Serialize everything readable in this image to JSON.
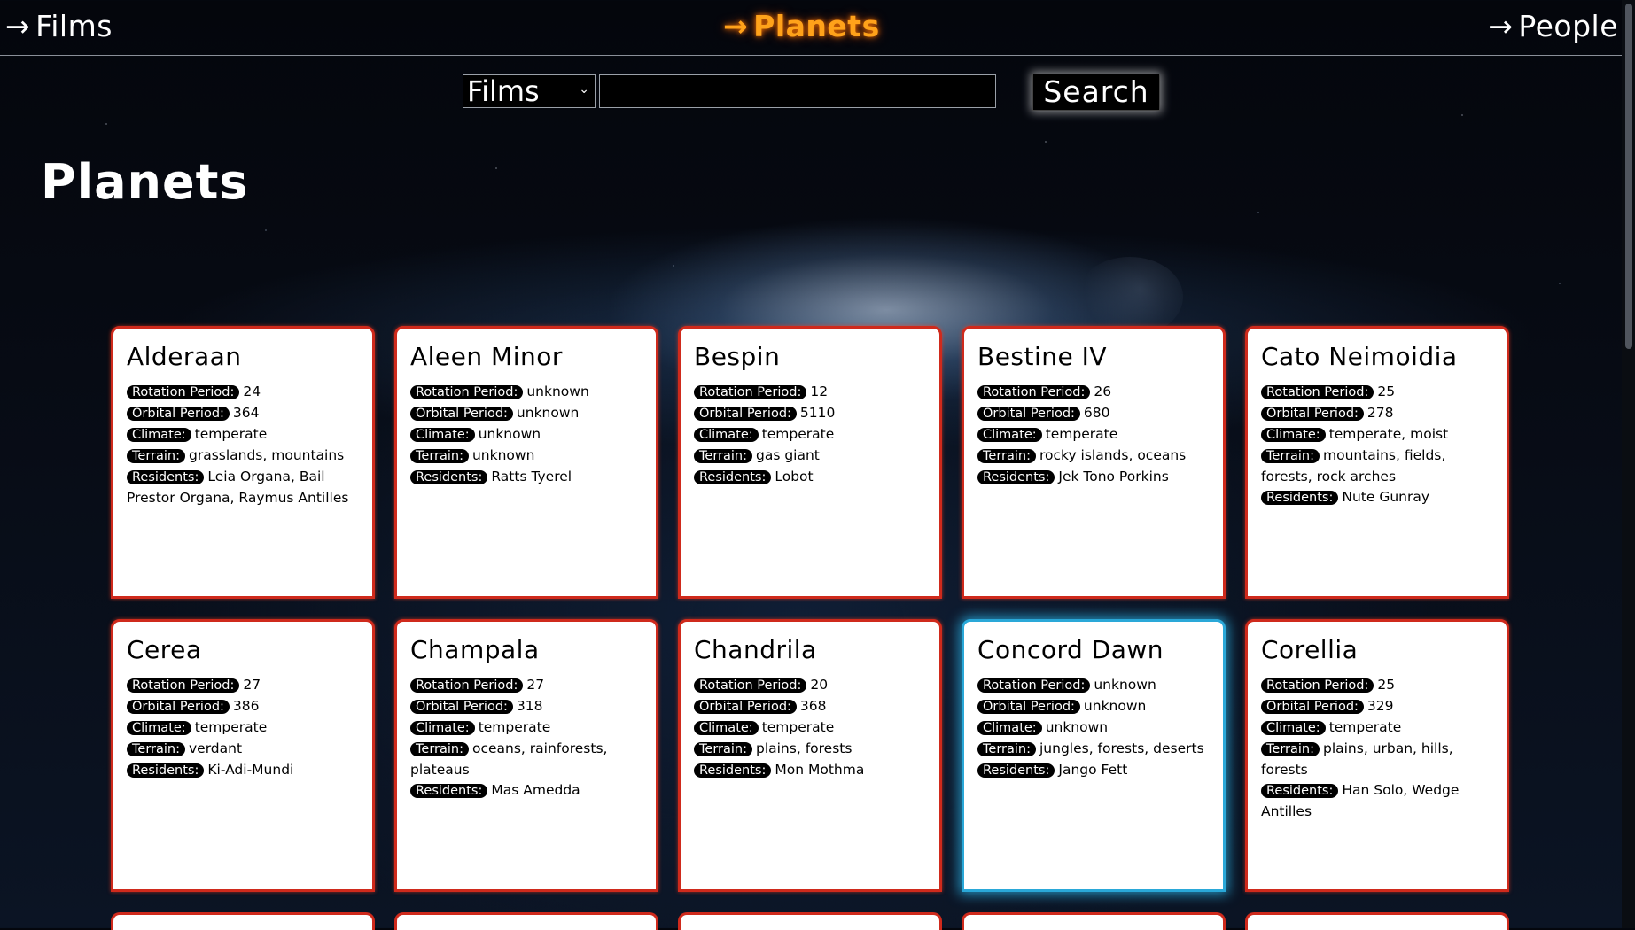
{
  "nav": {
    "arrow": "→",
    "films": "Films",
    "planets": "Planets",
    "people": "People"
  },
  "search": {
    "category": "Films",
    "query": "",
    "button": "Search"
  },
  "page_title": "Planets",
  "field_labels": {
    "rotation": "Rotation Period:",
    "orbital": "Orbital Period:",
    "climate": "Climate:",
    "terrain": "Terrain:",
    "residents": "Residents:"
  },
  "planets": [
    {
      "name": "Alderaan",
      "rotation": "24",
      "orbital": "364",
      "climate": "temperate",
      "terrain": "grasslands, mountains",
      "residents": "Leia Organa, Bail Prestor Organa, Raymus Antilles"
    },
    {
      "name": "Aleen Minor",
      "rotation": "unknown",
      "orbital": "unknown",
      "climate": "unknown",
      "terrain": "unknown",
      "residents": "Ratts Tyerel"
    },
    {
      "name": "Bespin",
      "rotation": "12",
      "orbital": "5110",
      "climate": "temperate",
      "terrain": "gas giant",
      "residents": "Lobot"
    },
    {
      "name": "Bestine IV",
      "rotation": "26",
      "orbital": "680",
      "climate": "temperate",
      "terrain": "rocky islands, oceans",
      "residents": "Jek Tono Porkins"
    },
    {
      "name": "Cato Neimoidia",
      "rotation": "25",
      "orbital": "278",
      "climate": "temperate, moist",
      "terrain": "mountains, fields, forests, rock arches",
      "residents": "Nute Gunray"
    },
    {
      "name": "Cerea",
      "rotation": "27",
      "orbital": "386",
      "climate": "temperate",
      "terrain": "verdant",
      "residents": "Ki-Adi-Mundi"
    },
    {
      "name": "Champala",
      "rotation": "27",
      "orbital": "318",
      "climate": "temperate",
      "terrain": "oceans, rainforests, plateaus",
      "residents": "Mas Amedda"
    },
    {
      "name": "Chandrila",
      "rotation": "20",
      "orbital": "368",
      "climate": "temperate",
      "terrain": "plains, forests",
      "residents": "Mon Mothma"
    },
    {
      "name": "Concord Dawn",
      "rotation": "unknown",
      "orbital": "unknown",
      "climate": "unknown",
      "terrain": "jungles, forests, deserts",
      "residents": "Jango Fett"
    },
    {
      "name": "Corellia",
      "rotation": "25",
      "orbital": "329",
      "climate": "temperate",
      "terrain": "plains, urban, hills, forests",
      "residents": "Han Solo, Wedge Antilles"
    }
  ]
}
